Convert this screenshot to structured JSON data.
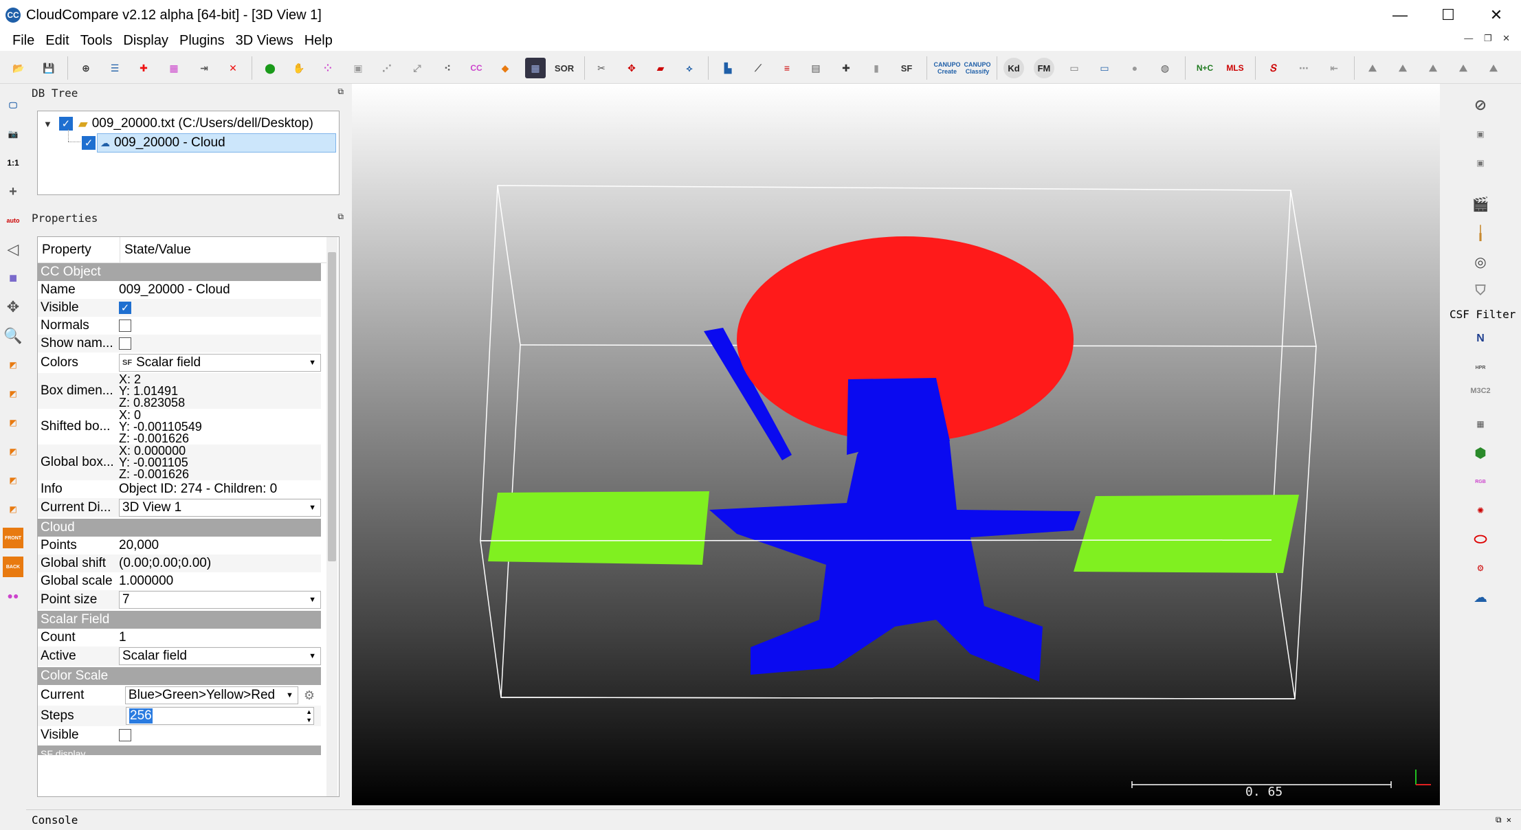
{
  "window": {
    "title": "CloudCompare v2.12 alpha [64-bit] - [3D View 1]",
    "logo": "CC",
    "minimize": "—",
    "maximize": "☐",
    "close": "✕"
  },
  "menu": [
    "File",
    "Edit",
    "Tools",
    "Display",
    "Plugins",
    "3D Views",
    "Help"
  ],
  "toolbar": {
    "sor_label": "SOR",
    "sf_label": "SF",
    "canupo_create": "CANUPO Create",
    "canupo_classify": "CANUPO Classify",
    "kd_label": "Kd",
    "fm_label": "FM",
    "nc_label": "N+C",
    "mls_label": "MLS"
  },
  "left_toolbar": {
    "one_to_one": "1:1",
    "auto": "auto",
    "front": "FRONT",
    "back": "BACK"
  },
  "db_tree": {
    "header": "DB Tree",
    "file_item": "009_20000.txt (C:/Users/dell/Desktop)",
    "cloud_item": "009_20000 - Cloud"
  },
  "properties": {
    "header": "Properties",
    "col_property": "Property",
    "col_value": "State/Value",
    "cc_object_section": "CC Object",
    "name_label": "Name",
    "name_value": "009_20000 - Cloud",
    "visible_label": "Visible",
    "normals_label": "Normals",
    "show_name_label": "Show nam...",
    "colors_label": "Colors",
    "colors_value": "Scalar field",
    "box_dim_label": "Box dimen...",
    "box_dim_x": "X: 2",
    "box_dim_y": "Y: 1.01491",
    "box_dim_z": "Z: 0.823058",
    "shifted_label": "Shifted bo...",
    "shifted_x": "X: 0",
    "shifted_y": "Y: -0.00110549",
    "shifted_z": "Z: -0.001626",
    "global_box_label": "Global box...",
    "global_box_x": "X: 0.000000",
    "global_box_y": "Y: -0.001105",
    "global_box_z": "Z: -0.001626",
    "info_label": "Info",
    "info_value": "Object ID: 274 - Children: 0",
    "current_display_label": "Current Di...",
    "current_display_value": "3D View 1",
    "cloud_section": "Cloud",
    "points_label": "Points",
    "points_value": "20,000",
    "global_shift_label": "Global shift",
    "global_shift_value": "(0.00;0.00;0.00)",
    "global_scale_label": "Global scale",
    "global_scale_value": "1.000000",
    "point_size_label": "Point size",
    "point_size_value": "7",
    "scalar_field_section": "Scalar Field",
    "count_label": "Count",
    "count_value": "1",
    "active_label": "Active",
    "active_value": "Scalar field",
    "color_scale_section": "Color Scale",
    "current_label": "Current",
    "current_value": "Blue>Green>Yellow>Red",
    "steps_label": "Steps",
    "steps_value": "256",
    "cs_visible_label": "Visible",
    "sf_partial": "SF display"
  },
  "view3d": {
    "scale_label": "0. 65",
    "colors": {
      "top": "#ff1a1a",
      "trunk": "#0a0af0",
      "side": "#80f020",
      "box": "#ffffff"
    }
  },
  "right_toolbar": {
    "csf_label": "CSF Filter",
    "n_label": "N",
    "m3c2_label": "M3C2",
    "hpr_label": "HPR",
    "rgb_label": "RGB"
  },
  "console": {
    "header": "Console"
  }
}
